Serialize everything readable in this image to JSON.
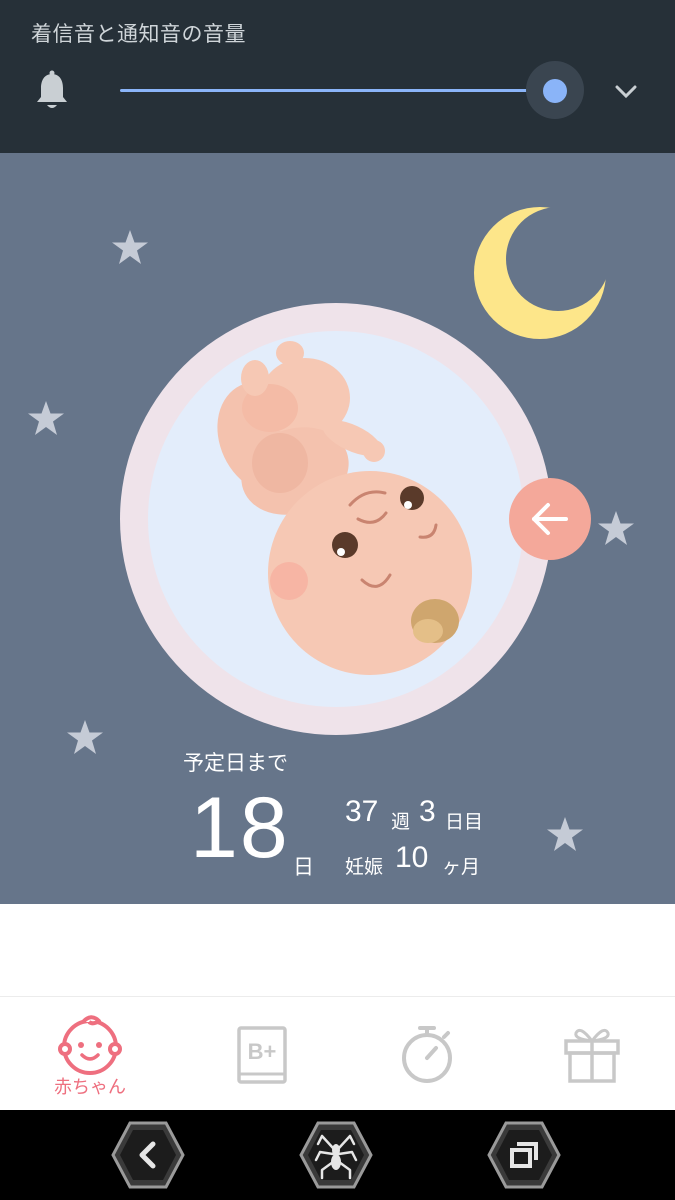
{
  "volume_panel": {
    "title": "着信音と通知音の音量",
    "level_percent": 100,
    "icons": {
      "ringer": "bell-icon",
      "expand": "chevron-down-icon"
    },
    "accent_color": "#8ab4f8"
  },
  "hero": {
    "background_color": "#66758a",
    "due_label": "予定日まで",
    "days_remaining": "18",
    "days_unit": "日",
    "week_number": "37",
    "week_unit": "週",
    "day_number": "3",
    "day_unit": "日目",
    "pregnancy_label": "妊娠",
    "month_number": "10",
    "month_unit": "ヶ月",
    "back_icon": "arrow-left-icon"
  },
  "tabs": [
    {
      "label": "赤ちゃん",
      "icon": "baby-face-icon",
      "active": true,
      "color": "#ee6f7f"
    },
    {
      "label": "",
      "icon": "book-icon",
      "active": false,
      "icon_text": "B+"
    },
    {
      "label": "",
      "icon": "stopwatch-icon",
      "active": false
    },
    {
      "label": "",
      "icon": "gift-icon",
      "active": false
    }
  ],
  "nav_bar": {
    "buttons": [
      "back-nav-icon",
      "home-spider-icon",
      "recents-nav-icon"
    ]
  }
}
